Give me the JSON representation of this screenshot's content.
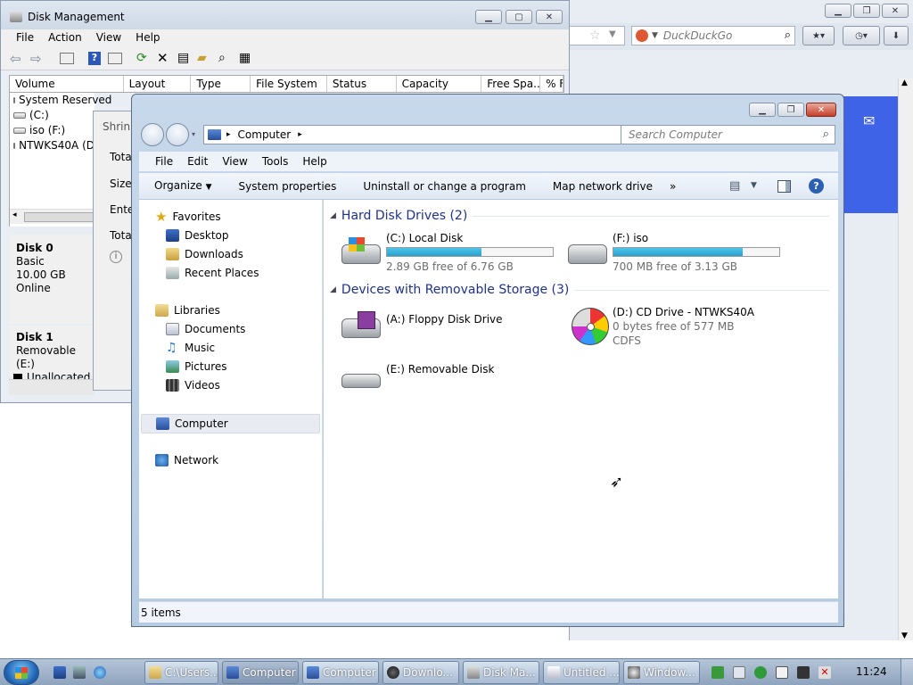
{
  "browser": {
    "search_placeholder": "DuckDuckGo"
  },
  "diskmgmt": {
    "title": "Disk Management",
    "menu": [
      "File",
      "Action",
      "View",
      "Help"
    ],
    "columns": [
      "Volume",
      "Layout",
      "Type",
      "File System",
      "Status",
      "Capacity",
      "Free Spa...",
      "% F"
    ],
    "volumes": [
      "System Reserved",
      "(C:)",
      "iso (F:)",
      "NTWKS40A (D"
    ],
    "disk0": {
      "name": "Disk 0",
      "type": "Basic",
      "size": "10.00 GB",
      "state": "Online"
    },
    "disk1": {
      "name": "Disk 1",
      "type": "Removable (E:)",
      "legend": "Unallocated"
    }
  },
  "shrink": {
    "title": "Shrink",
    "rows": [
      "Total",
      "Size",
      "Enter",
      "Total"
    ]
  },
  "explorer": {
    "address": "Computer",
    "search_placeholder": "Search Computer",
    "menu": [
      "File",
      "Edit",
      "View",
      "Tools",
      "Help"
    ],
    "commands": [
      "Organize",
      "System properties",
      "Uninstall or change a program",
      "Map network drive"
    ],
    "more": "»",
    "nav": {
      "favorites": "Favorites",
      "desktop": "Desktop",
      "downloads": "Downloads",
      "recent": "Recent Places",
      "libraries": "Libraries",
      "documents": "Documents",
      "music": "Music",
      "pictures": "Pictures",
      "videos": "Videos",
      "computer": "Computer",
      "network": "Network"
    },
    "groups": {
      "hdd": "Hard Disk Drives (2)",
      "removable": "Devices with Removable Storage (3)"
    },
    "drives": {
      "c": {
        "name": "(C:) Local Disk",
        "free": "2.89 GB free of 6.76 GB",
        "used_fraction": 0.57
      },
      "f": {
        "name": "(F:) iso",
        "free": "700 MB free of 3.13 GB",
        "used_fraction": 0.78
      },
      "a": {
        "name": "(A:) Floppy Disk Drive"
      },
      "d": {
        "name": "(D:) CD Drive - NTWKS40A",
        "free": "0 bytes free of 577 MB",
        "fs": "CDFS"
      },
      "e": {
        "name": "(E:) Removable Disk"
      }
    },
    "status": "5 items"
  },
  "taskbar": {
    "buttons": [
      "C:\\Users...",
      "Computer",
      "Computer",
      "Downlo...",
      "Disk Ma...",
      "Untitled ...",
      "Window..."
    ],
    "clock": "11:24"
  }
}
